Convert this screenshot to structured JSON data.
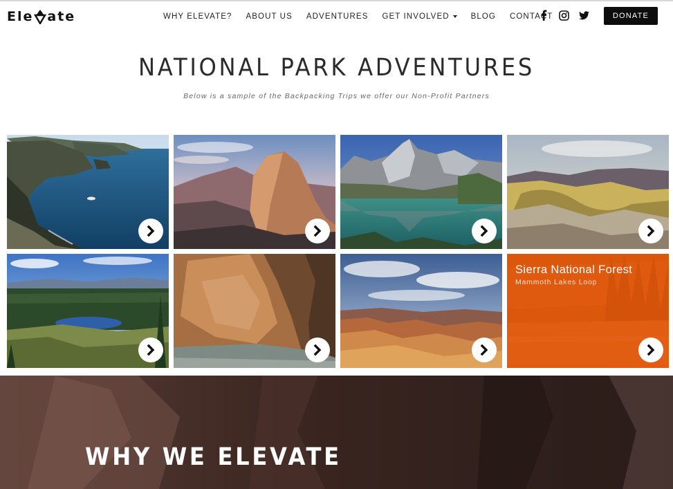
{
  "brand": {
    "name_left": "Ele",
    "name_right": "ate"
  },
  "nav": {
    "items": [
      {
        "label": "WHY ELEVATE?"
      },
      {
        "label": "ABOUT US"
      },
      {
        "label": "ADVENTURES"
      },
      {
        "label": "GET INVOLVED"
      },
      {
        "label": "BLOG"
      },
      {
        "label": "CONTACT"
      }
    ]
  },
  "social": [
    "facebook-icon",
    "instagram-icon",
    "twitter-icon"
  ],
  "donate_label": "DONATE",
  "hero": {
    "title": "NATIONAL PARK ADVENTURES",
    "subtitle": "Below is a sample of the Backpacking Trips we offer our Non-Profit Partners"
  },
  "featured_card": {
    "title": "Sierra National Forest",
    "subtitle": "Mammoth Lakes Loop"
  },
  "section": {
    "title": "WHY WE ELEVATE"
  },
  "colors": {
    "accent_orange": "#e85a0a",
    "donate_bg": "#0d0d0d",
    "band_bg": "#3a2520"
  }
}
